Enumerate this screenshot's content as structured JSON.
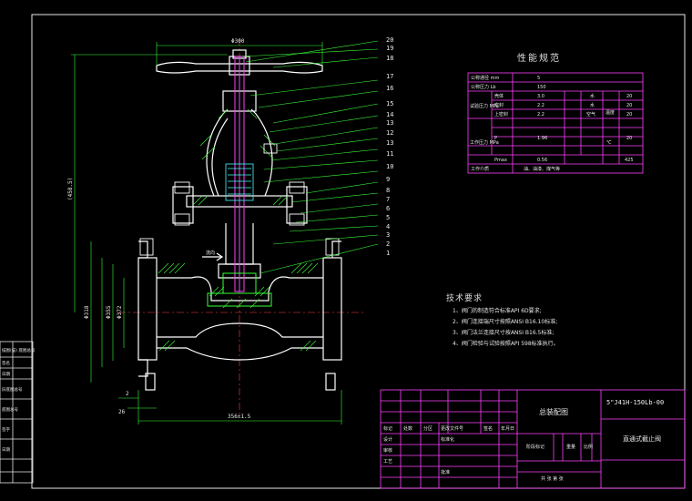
{
  "part_numbers": [
    "20",
    "19",
    "18",
    "17",
    "16",
    "15",
    "14",
    "13",
    "12",
    "13",
    "11",
    "10",
    "9",
    "8",
    "7",
    "6",
    "5",
    "4",
    "3",
    "2",
    "1"
  ],
  "dimensions": {
    "handwheel_dia": "Φ300",
    "height": "(458.5)",
    "flange_dia_1": "Φ318",
    "flange_dia_2": "Φ355",
    "flange_dia_3": "Φ372",
    "face_to_face": "356±1.5",
    "flange_thk": "26",
    "raised_face": "2",
    "flow_label": "流向"
  },
  "performance": {
    "title": "性能规范",
    "rows": [
      {
        "label": "公称通径 mm",
        "value": "5"
      },
      {
        "label": "公称压力 Lb",
        "value": "150"
      },
      {
        "label": "壳体",
        "value": "3.0"
      },
      {
        "label": "密封",
        "value": "2.2"
      },
      {
        "label": "上密封",
        "value": "2.2"
      },
      {
        "label": "P",
        "value": "1.96"
      },
      {
        "label": "Pmax",
        "value": "0.56"
      },
      {
        "label": "工作介质",
        "value": "油、油漆、煤气等"
      }
    ],
    "group_labels": [
      "试验压力 MPa",
      "工作压力 MPa"
    ],
    "right_labels": [
      "水",
      "水",
      "空气",
      "温度",
      "℃"
    ],
    "right_values": [
      "20",
      "20",
      "20",
      "20",
      "425"
    ]
  },
  "tech_requirements": {
    "title": "技术要求",
    "items": [
      "1、阀门的制造符合标准API 6D要求;",
      "2、阀门连接端尺寸按照ANSI B16.10标准;",
      "3、阀门法兰连接尺寸按ANSI B16.5标准;",
      "4、阀门检验与试验按照API 598标准执行。"
    ]
  },
  "title_block": {
    "drawing_name": "总装配图",
    "model": "5\"J41H-150Lb-00",
    "product_name": "直通式截止阀",
    "header_cells": [
      "标记",
      "处数",
      "分区",
      "更改文件号",
      "签名",
      "年月日"
    ],
    "left_labels": [
      "设计",
      "标准化",
      "审核",
      "工艺",
      "批准"
    ],
    "stage_labels": [
      "阶段标记",
      "重量",
      "比例"
    ],
    "sheet_label": "共 张 第 张"
  },
  "side_table": {
    "labels": [
      "描图(描) 底图总号",
      "签名",
      "日期",
      "旧底图总号",
      "底图总号",
      "签字",
      "日期"
    ]
  }
}
